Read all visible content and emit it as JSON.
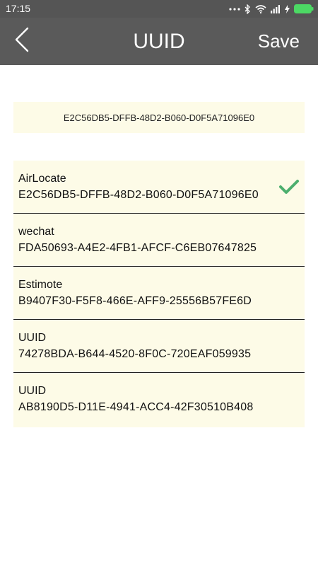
{
  "status_bar": {
    "time": "17:15",
    "icons": [
      "more-dots-icon",
      "bluetooth-icon",
      "wifi-icon",
      "signal-icon",
      "charging-icon",
      "battery-icon"
    ]
  },
  "app_bar": {
    "back_icon": "chevron-left-icon",
    "title": "UUID",
    "save_label": "Save"
  },
  "uuid_input": {
    "value": "E2C56DB5-DFFB-48D2-B060-D0F5A71096E0"
  },
  "uuid_list": {
    "items": [
      {
        "name": "AirLocate",
        "value": "E2C56DB5-DFFB-48D2-B060-D0F5A71096E0",
        "selected": true
      },
      {
        "name": "wechat",
        "value": "FDA50693-A4E2-4FB1-AFCF-C6EB07647825",
        "selected": false
      },
      {
        "name": "Estimote",
        "value": "B9407F30-F5F8-466E-AFF9-25556B57FE6D",
        "selected": false
      },
      {
        "name": "UUID",
        "value": "74278BDA-B644-4520-8F0C-720EAF059935",
        "selected": false
      },
      {
        "name": "UUID",
        "value": "AB8190D5-D11E-4941-ACC4-42F30510B408",
        "selected": false
      }
    ]
  },
  "colors": {
    "app_bar": "#5a5a5a",
    "list_background": "#fdfbe7",
    "check_mark": "#4caf6e",
    "battery": "#4cd964"
  }
}
